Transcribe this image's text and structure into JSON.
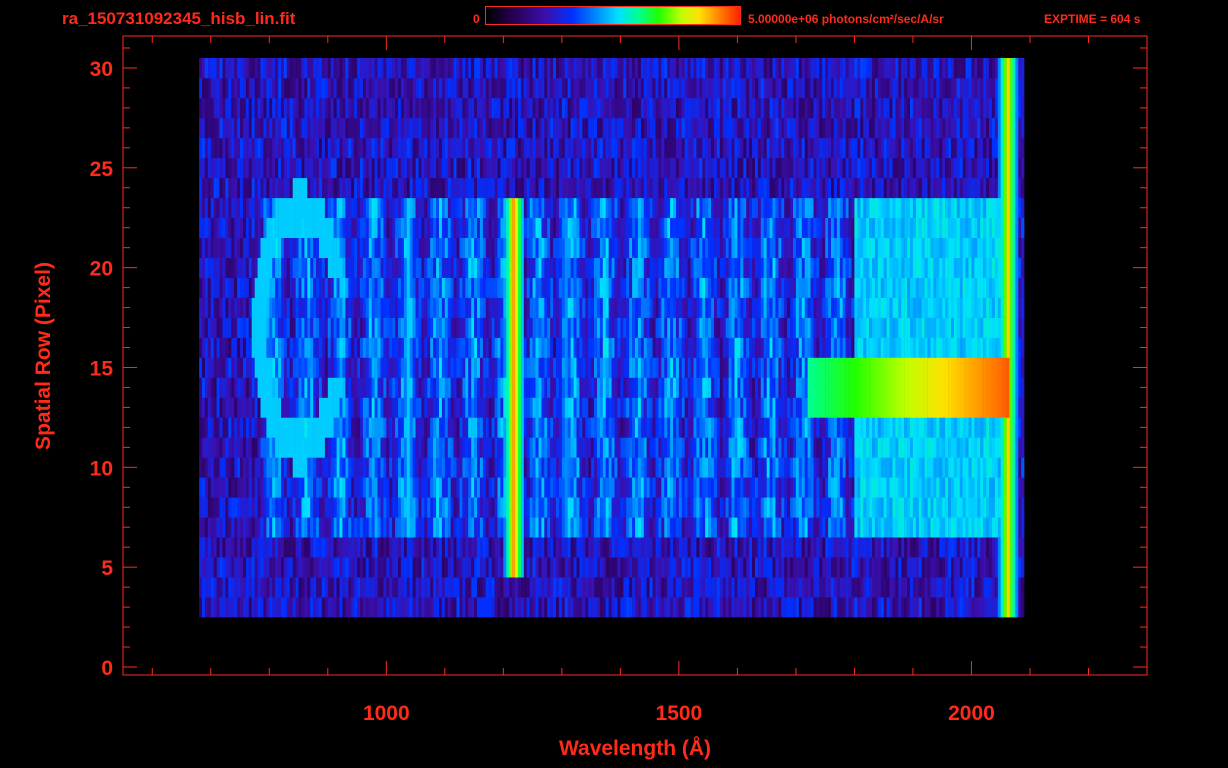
{
  "header": {
    "filename": "ra_150731092345_hisb_lin.fit",
    "colorbar_min_label": "0",
    "colorbar_max_label": "5.00000e+06 photons/cm²/sec/A/sr",
    "exptime_label": "EXPTIME = 604 s"
  },
  "colors": {
    "axis": "#ff2a1a",
    "background": "#000000"
  },
  "chart_data": {
    "type": "heatmap",
    "xlabel": "Wavelength (Å)",
    "ylabel": "Spatial Row (Pixel)",
    "xlim": [
      550,
      2300
    ],
    "ylim": [
      -0.4,
      31.6
    ],
    "x_ticks": [
      1000,
      1500,
      2000
    ],
    "y_ticks": [
      0,
      5,
      10,
      15,
      20,
      25,
      30
    ],
    "colorbar": {
      "min": 0,
      "max": 5000000,
      "units": "photons/cm²/sec/A/sr"
    },
    "data_extent_x": [
      680,
      2065
    ],
    "data_extent_rows": [
      3,
      30
    ],
    "features": [
      {
        "wavelength": 1216,
        "rows": [
          5,
          23
        ],
        "level": 0.92
      },
      {
        "wavelength": 1035,
        "rows": [
          7,
          23
        ],
        "level": 0.5
      },
      {
        "wavelength": 1304,
        "rows": [
          7,
          23
        ],
        "level": 0.45
      },
      {
        "wavelength": 2060,
        "rows": [
          0,
          30
        ],
        "level": 0.85
      }
    ],
    "bright_band": {
      "wavelength_range": [
        1720,
        2060
      ],
      "rows": [
        13,
        15
      ],
      "level": 0.8
    },
    "continuum_region": {
      "wavelength_range": [
        1800,
        2060
      ],
      "rows": [
        7,
        23
      ],
      "level": 0.55
    },
    "ring_feature": {
      "center_wavelength": 850,
      "center_row": 17,
      "level": 0.5
    }
  }
}
